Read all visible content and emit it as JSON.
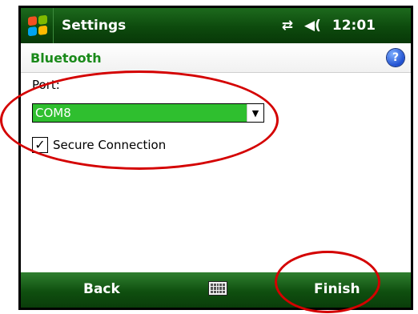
{
  "titlebar": {
    "app_title": "Settings",
    "time": "12:01",
    "connectivity_icon": "sync-arrows-icon",
    "volume_icon": "speaker-icon",
    "start_icon": "windows-logo-icon"
  },
  "header": {
    "title": "Bluetooth",
    "help_label": "?"
  },
  "form": {
    "port_label": "Port:",
    "port_selected": "COM8",
    "secure_connection_label": "Secure Connection",
    "secure_connection_checked": true
  },
  "menubar": {
    "left_softkey": "Back",
    "right_softkey": "Finish",
    "keyboard_icon": "keyboard-icon"
  },
  "colors": {
    "accent_green": "#1a8a1a",
    "selection_green": "#2fbf2f",
    "annotation_red": "#d40000"
  }
}
